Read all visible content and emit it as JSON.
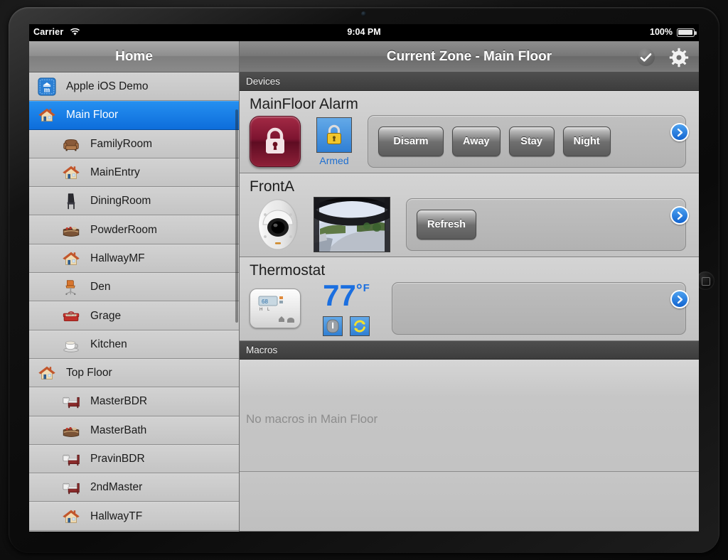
{
  "status_bar": {
    "carrier": "Carrier",
    "wifi_icon": "wifi-icon",
    "time": "9:04 PM",
    "battery_percent": "100%",
    "battery_icon": "battery-full-icon"
  },
  "sidebar": {
    "title": "Home",
    "items": [
      {
        "label": "Apple iOS Demo",
        "icon": "app-logo-icon",
        "indent": false,
        "selected": false
      },
      {
        "label": "Main Floor",
        "icon": "house-icon",
        "indent": false,
        "selected": true
      },
      {
        "label": "FamilyRoom",
        "icon": "armchair-icon",
        "indent": true,
        "selected": false
      },
      {
        "label": "MainEntry",
        "icon": "house-icon",
        "indent": true,
        "selected": false
      },
      {
        "label": "DiningRoom",
        "icon": "chair-icon",
        "indent": true,
        "selected": false
      },
      {
        "label": "PowderRoom",
        "icon": "cake-icon",
        "indent": true,
        "selected": false
      },
      {
        "label": "HallwayMF",
        "icon": "house-icon",
        "indent": true,
        "selected": false
      },
      {
        "label": "Den",
        "icon": "office-chair-icon",
        "indent": true,
        "selected": false
      },
      {
        "label": "Grage",
        "icon": "toolbox-icon",
        "indent": true,
        "selected": false
      },
      {
        "label": "Kitchen",
        "icon": "coffee-cup-icon",
        "indent": true,
        "selected": false
      },
      {
        "label": "Top Floor",
        "icon": "house-icon",
        "indent": false,
        "selected": false
      },
      {
        "label": "MasterBDR",
        "icon": "bed-icon",
        "indent": true,
        "selected": false
      },
      {
        "label": "MasterBath",
        "icon": "cake-icon",
        "indent": true,
        "selected": false
      },
      {
        "label": "PravinBDR",
        "icon": "bed-icon",
        "indent": true,
        "selected": false
      },
      {
        "label": "2ndMaster",
        "icon": "bed-icon",
        "indent": true,
        "selected": false
      },
      {
        "label": "HallwayTF",
        "icon": "house-icon",
        "indent": true,
        "selected": false
      }
    ]
  },
  "content": {
    "title": "Current Zone - Main Floor",
    "check_icon": "checkmark-icon",
    "gear_icon": "gear-icon",
    "devices_section_label": "Devices",
    "macros_section_label": "Macros",
    "macros_empty_text": "No macros in Main Floor",
    "devices": [
      {
        "name": "MainFloor Alarm",
        "status_label": "Armed",
        "buttons": [
          "Disarm",
          "Away",
          "Stay",
          "Night"
        ]
      },
      {
        "name": "FrontA",
        "buttons": [
          "Refresh"
        ]
      },
      {
        "name": "Thermostat",
        "temperature": "77",
        "degree_symbol": "°",
        "unit": "F"
      }
    ]
  },
  "colors": {
    "accent_blue": "#1b6fe0",
    "selected_row": "#0d6ddb",
    "alarm_red": "#7d1430",
    "header_grey": "#6a6a6a",
    "section_bar": "#3d3d3d"
  }
}
